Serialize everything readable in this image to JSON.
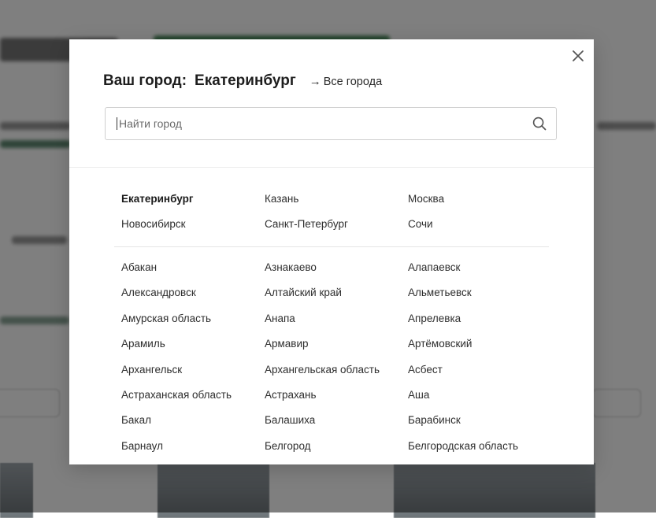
{
  "modal": {
    "title": "Ваш город:",
    "current_city": "Екатеринбург",
    "all_cities_link": "Все города",
    "search": {
      "placeholder": "Найти город",
      "value": ""
    },
    "popular_cities": [
      "Екатеринбург",
      "Казань",
      "Москва",
      "Новосибирск",
      "Санкт-Петербург",
      "Сочи"
    ],
    "cities": [
      "Абакан",
      "Азнакаево",
      "Алапаевск",
      "Александровск",
      "Алтайский край",
      "Альметьевск",
      "Амурская область",
      "Анапа",
      "Апрелевка",
      "Арамиль",
      "Армавир",
      "Артёмовский",
      "Архангельск",
      "Архангельская область",
      "Асбест",
      "Астраханская область",
      "Астрахань",
      "Аша",
      "Бакал",
      "Балашиха",
      "Барабинск",
      "Барнаул",
      "Белгород",
      "Белгородская область"
    ]
  },
  "icons": {
    "close": "close-icon",
    "search": "search-icon",
    "arrow": "arrow-right-icon"
  },
  "colors": {
    "overlay": "#00000080",
    "modal_bg": "#ffffff",
    "text": "#2e2e2e"
  }
}
